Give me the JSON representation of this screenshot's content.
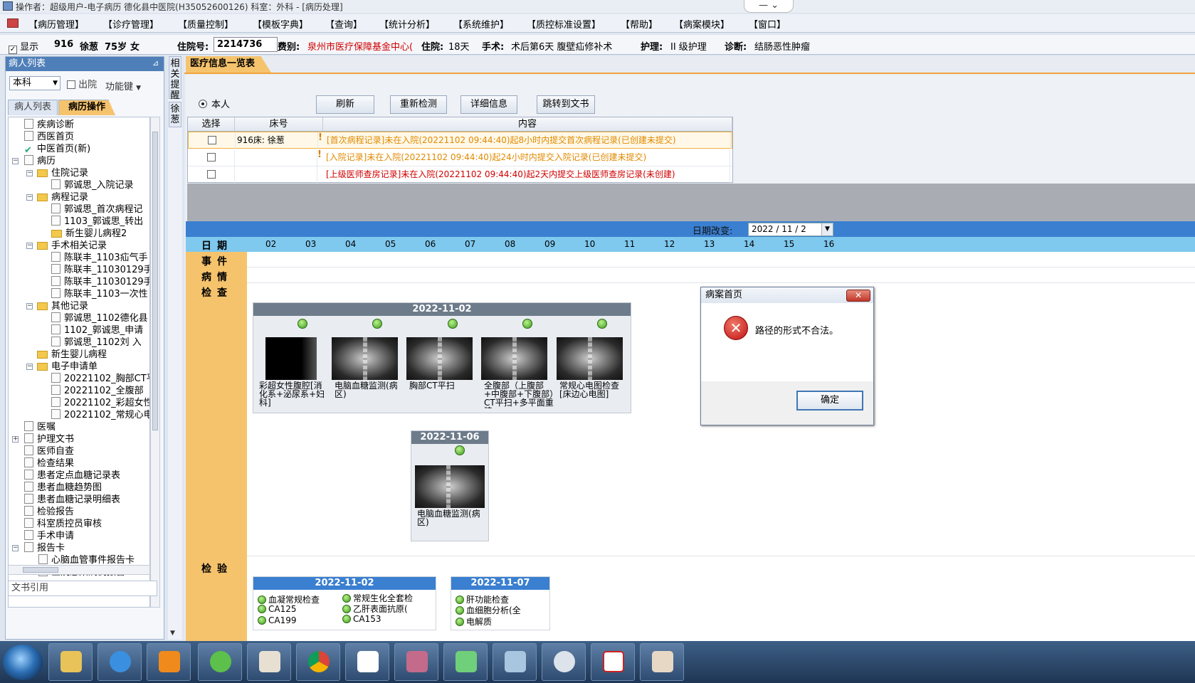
{
  "titlebar": {
    "text": "操作者：超级用户-电子病历  德化县中医院(H35052600126)  科室：外科 - [病历处理]",
    "window_controls": "—  ⌄"
  },
  "menu": [
    "【病历管理】",
    "【诊疗管理】",
    "【质量控制】",
    "【模板字典】",
    "【查询】",
    "【统计分析】",
    "【系统维护】",
    "【质控标准设置】",
    "【帮助】",
    "【病案模块】",
    "【窗口】"
  ],
  "patient_bar": {
    "show_label": "显示",
    "bed": "916",
    "name": "徐葱",
    "age": "75岁",
    "sex": "女",
    "admission_label": "住院号:",
    "admission_no": "2214736",
    "category_label": "费别:",
    "category_value": "泉州市医疗保障基金中心(",
    "stay_label": "住院:",
    "stay_value": "18天",
    "surgery_label": "手术:",
    "surgery_value": "术后第6天  腹壁疝修补术",
    "nursing_label": "护理:",
    "nursing_value": "II 级护理",
    "diagnosis_label": "诊断:",
    "diagnosis_value": "结肠恶性肿瘤"
  },
  "left_panel": {
    "title": "病人列表",
    "pin": "⊿",
    "dept_select": "本科",
    "discharged_label": "出院",
    "function_key": "功能键",
    "tabs": [
      "病人列表",
      "病历操作"
    ],
    "doc_ref": "文书引用",
    "tree": [
      {
        "label": "疾病诊断"
      },
      {
        "label": "西医首页"
      },
      {
        "label": "中医首页(新)"
      },
      {
        "label": "病历"
      },
      {
        "label": "住院记录"
      },
      {
        "label": "郭诚思_入院记录"
      },
      {
        "label": "病程记录"
      },
      {
        "label": "郭诚思_首次病程记"
      },
      {
        "label": "1103_郭诚思_转出"
      },
      {
        "label": "新生婴儿病程2"
      },
      {
        "label": "手术相关记录"
      },
      {
        "label": "陈联丰_1103疝气手"
      },
      {
        "label": "陈联丰_11030129手"
      },
      {
        "label": "陈联丰_11030129手"
      },
      {
        "label": "陈联丰_1103一次性"
      },
      {
        "label": "其他记录"
      },
      {
        "label": "郭诚思_1102德化县"
      },
      {
        "label": "1102_郭诚思_申请"
      },
      {
        "label": "郭诚思_1102刘 入"
      },
      {
        "label": "新生婴儿病程"
      },
      {
        "label": "电子申请单"
      },
      {
        "label": "20221102_胸部CT平"
      },
      {
        "label": "20221102_全腹部"
      },
      {
        "label": "20221102_彩超女性"
      },
      {
        "label": "20221102_常规心电"
      },
      {
        "label": "医嘱"
      },
      {
        "label": "护理文书"
      },
      {
        "label": "医师自查"
      },
      {
        "label": "检查结果"
      },
      {
        "label": "患者定点血糖记录表"
      },
      {
        "label": "患者血糖趋势图"
      },
      {
        "label": "患者血糖记录明细表"
      },
      {
        "label": "检验报告"
      },
      {
        "label": "科室质控员审核"
      },
      {
        "label": "手术申请"
      },
      {
        "label": "报告卡"
      },
      {
        "label": "心脑血管事件报告卡"
      },
      {
        "label": "医院感染病例报告"
      }
    ]
  },
  "vtabs": [
    "相关提醒",
    "徐葱"
  ],
  "med_panel": {
    "tab": "医疗信息一览表",
    "self_label": "本人",
    "buttons": [
      "刷新",
      "重新检测",
      "详细信息",
      "跳转到文书"
    ],
    "columns": [
      "选择",
      "床号",
      "内容"
    ],
    "rows": [
      {
        "bed": "916床: 徐葱",
        "content": "[首次病程记录]未在入院(20221102  09:44:40)起8小时内提交首次病程记录(已创建未提交)",
        "color": "#e08a00"
      },
      {
        "bed": "",
        "content": "[入院记录]未在入院(20221102  09:44:40)起24小时内提交入院记录(已创建未提交)",
        "color": "#e08a00"
      },
      {
        "bed": "",
        "content": "[上级医师查房记录]未在入院(20221102  09:44:40)起2天内提交上级医师查房记录(未创建)",
        "color": "#d00000"
      }
    ]
  },
  "timeline": {
    "date_change_label": "日期改变:",
    "date_value": "2022 / 11 / 2",
    "days": [
      "02",
      "03",
      "04",
      "05",
      "06",
      "07",
      "08",
      "09",
      "10",
      "11",
      "12",
      "13",
      "14",
      "15",
      "16"
    ],
    "rows": [
      "日期",
      "事件",
      "病情",
      "检查",
      "检验"
    ],
    "exam_groups": [
      {
        "date": "2022-11-02",
        "items": [
          "彩超女性腹腔[消化系+泌尿系+妇科]",
          "电脑血糖监测(病区)",
          "胸部CT平扫",
          "全腹部（上腹部+中腹部+下腹部）CT平扫+多平面重建",
          "常规心电图检查[床边心电图]"
        ]
      },
      {
        "date": "2022-11-06",
        "items": [
          "电脑血糖监测(病区)"
        ]
      }
    ],
    "lab_groups": [
      {
        "date": "2022-11-02",
        "items": [
          "血凝常规检查",
          "常规生化全套检",
          "CA125",
          "乙肝表面抗原(",
          "CA199",
          "CA153"
        ]
      },
      {
        "date": "2022-11-07",
        "items": [
          "肝功能检查",
          "血细胞分析(全",
          "电解质"
        ]
      }
    ]
  },
  "dialog": {
    "title": "病案首页",
    "message": "路径的形式不合法。",
    "ok": "确定",
    "close": "✕"
  },
  "colors": {
    "accent_orange": "#f6c36d",
    "header_blue": "#3a7fd0",
    "warn_orange": "#e08a00",
    "error_red": "#d00000"
  }
}
